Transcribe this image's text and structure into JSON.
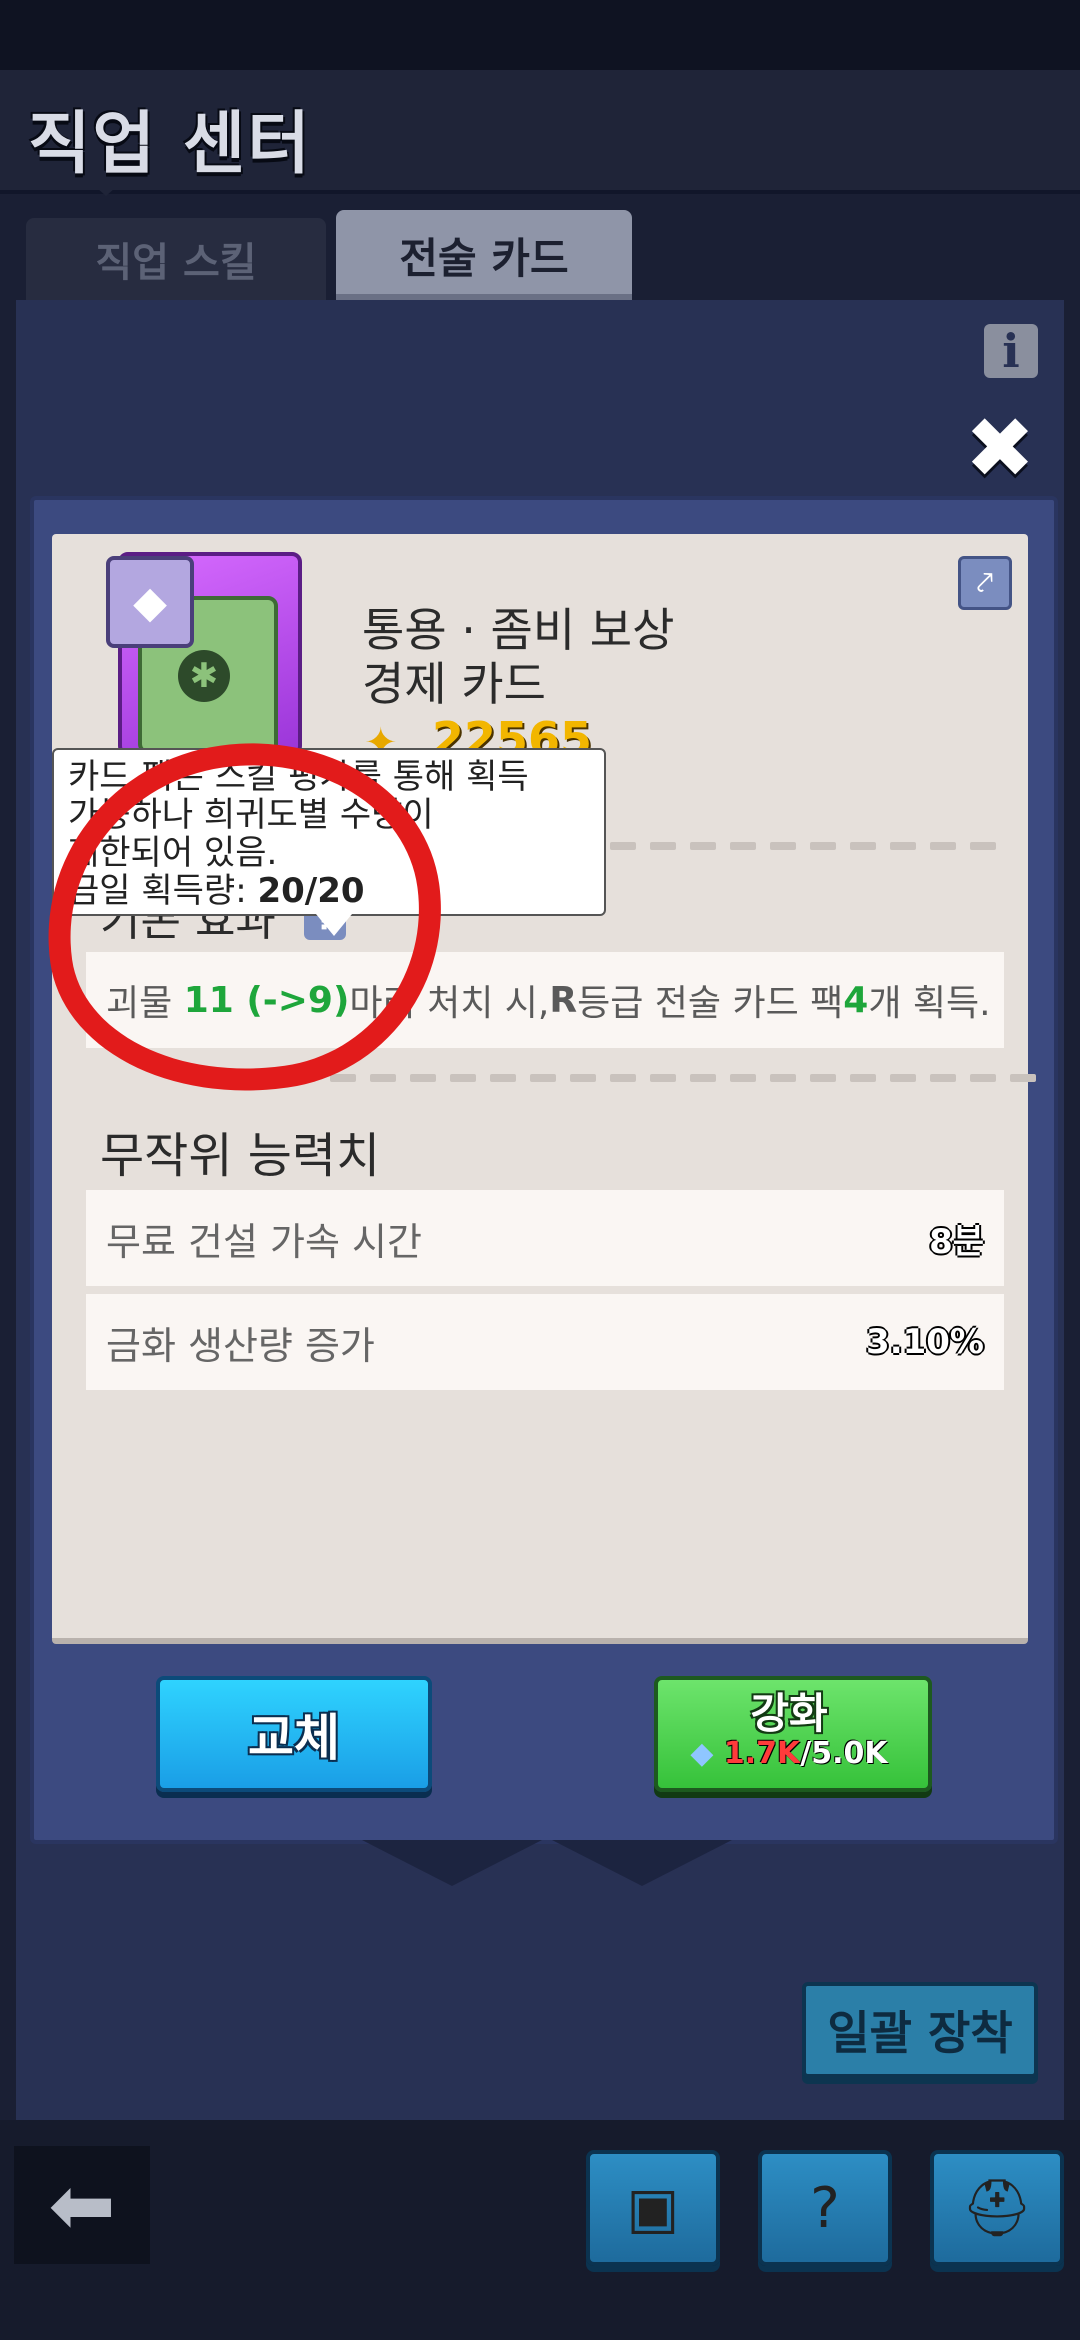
{
  "header": {
    "title": "직업 센터"
  },
  "tabs": [
    {
      "label": "직업 스킬",
      "active": false
    },
    {
      "label": "전술 카드",
      "active": true
    }
  ],
  "card": {
    "title_line1": "통용 · 좀비 보상",
    "title_line2": "경제 카드",
    "gold_value": "22565"
  },
  "tooltip": {
    "text_line1": "카드 팩은 스킬 평가를 통해 획득",
    "text_line2": "가능하나 희귀도별 수량이",
    "text_line3": "제한되어 있음.",
    "count_label": "금일 획득량: ",
    "count_value": "20/20"
  },
  "effect": {
    "label": "기본 효과",
    "text_prefix": "괴물 ",
    "kills": "11 (->9)",
    "text_mid": "마리 처치 시, ",
    "grade": "R",
    "text_mid2": "등급 전술 카드 팩 ",
    "packs": "4",
    "text_suffix": "개 획득."
  },
  "random_stats": {
    "title": "무작위 능력치",
    "rows": [
      {
        "label": "무료 건설 가속 시간",
        "value": "8분"
      },
      {
        "label": "금화 생산량 증가",
        "value": "3.10%"
      }
    ]
  },
  "buttons": {
    "swap": "교체",
    "upgrade": "강화",
    "upgrade_cost_have": "1.7K",
    "upgrade_cost_need": "/5.0K",
    "equip_all": "일괄 장착"
  },
  "colors": {
    "accent_green": "#1ea63b",
    "annotation_red": "#e21b1b",
    "gold": "#f2b600"
  },
  "icons": [
    "info-icon",
    "close-icon",
    "share-icon",
    "gold-icon",
    "gem-icon",
    "back-arrow-icon",
    "book-icon",
    "help-cards-icon",
    "helmet-icon"
  ]
}
